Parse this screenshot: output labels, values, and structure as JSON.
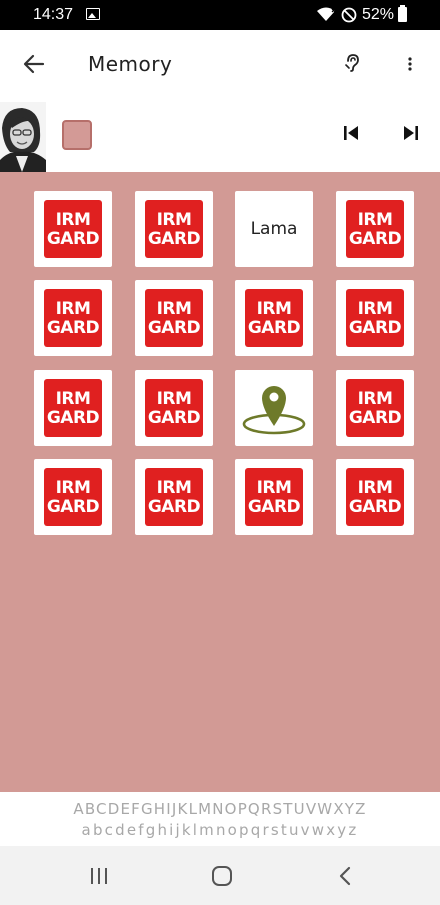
{
  "status_bar": {
    "time": "14:37",
    "battery": "52%",
    "icons": [
      "image-icon",
      "wifi-icon",
      "do-not-disturb-icon",
      "battery-icon"
    ]
  },
  "app_bar": {
    "title": "Memory",
    "icons": [
      "back-arrow-icon",
      "ear-icon",
      "more-vert-icon"
    ]
  },
  "player": {
    "swatch_color": "#d39a96",
    "controls": [
      "skip-previous-icon",
      "skip-next-icon"
    ]
  },
  "board": {
    "background": "#d29a95",
    "cards": [
      {
        "type": "logo",
        "line1": "IRM",
        "line2": "GARD"
      },
      {
        "type": "logo",
        "line1": "IRM",
        "line2": "GARD"
      },
      {
        "type": "word",
        "text": "Lama"
      },
      {
        "type": "logo",
        "line1": "IRM",
        "line2": "GARD"
      },
      {
        "type": "logo",
        "line1": "IRM",
        "line2": "GARD"
      },
      {
        "type": "logo",
        "line1": "IRM",
        "line2": "GARD"
      },
      {
        "type": "logo",
        "line1": "IRM",
        "line2": "GARD"
      },
      {
        "type": "logo",
        "line1": "IRM",
        "line2": "GARD"
      },
      {
        "type": "logo",
        "line1": "IRM",
        "line2": "GARD"
      },
      {
        "type": "logo",
        "line1": "IRM",
        "line2": "GARD"
      },
      {
        "type": "icon",
        "icon": "location-pin-icon"
      },
      {
        "type": "logo",
        "line1": "IRM",
        "line2": "GARD"
      },
      {
        "type": "logo",
        "line1": "IRM",
        "line2": "GARD"
      },
      {
        "type": "logo",
        "line1": "IRM",
        "line2": "GARD"
      },
      {
        "type": "logo",
        "line1": "IRM",
        "line2": "GARD"
      },
      {
        "type": "logo",
        "line1": "IRM",
        "line2": "GARD"
      }
    ]
  },
  "alphabet": {
    "upper": "ABCDEFGHIJKLMNOPQRSTUVWXYZ",
    "lower": "abcdefghijklmnopqrstuvwxyz"
  },
  "nav_bar": {
    "icons": [
      "recent-apps-icon",
      "home-icon",
      "back-nav-icon"
    ]
  },
  "colors": {
    "logo_red": "#e02020",
    "pin_green": "#6e7a2a",
    "swatch_border": "#b66f6a"
  }
}
